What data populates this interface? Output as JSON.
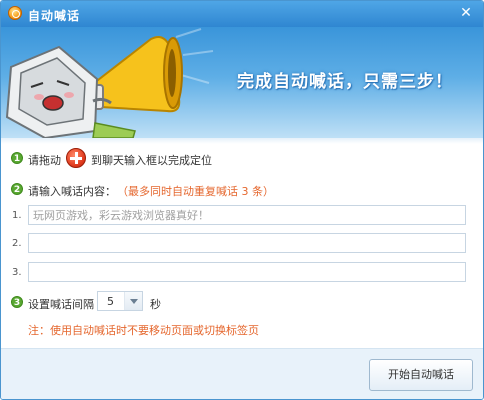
{
  "window": {
    "title": "自动喊话"
  },
  "banner": {
    "slogan": "完成自动喊话，只需三步！"
  },
  "step1": {
    "number": "1",
    "prefix": "请拖动",
    "suffix": "到聊天输入框以完成定位"
  },
  "step2": {
    "number": "2",
    "label": "请输入喊话内容：",
    "hint": "（最多同时自动重复喊话 3 条）"
  },
  "messages": [
    {
      "index": "1.",
      "value": "",
      "placeholder": "玩网页游戏，彩云游戏浏览器真好！"
    },
    {
      "index": "2.",
      "value": "",
      "placeholder": ""
    },
    {
      "index": "3.",
      "value": "",
      "placeholder": ""
    }
  ],
  "step3": {
    "number": "3",
    "label": "设置喊话间隔",
    "interval": "5",
    "unit": "秒"
  },
  "note": "注：使用自动喊话时不要移动页面或切换标签页",
  "footer": {
    "start_label": "开始自动喊话"
  },
  "colors": {
    "titlebar": "#3a95da",
    "step": "#5aa832",
    "accent": "#e5672e"
  },
  "icons": [
    "app-logo-icon",
    "close-icon",
    "drag-target-icon",
    "dropdown-arrow-icon",
    "megaphone-illustration"
  ]
}
